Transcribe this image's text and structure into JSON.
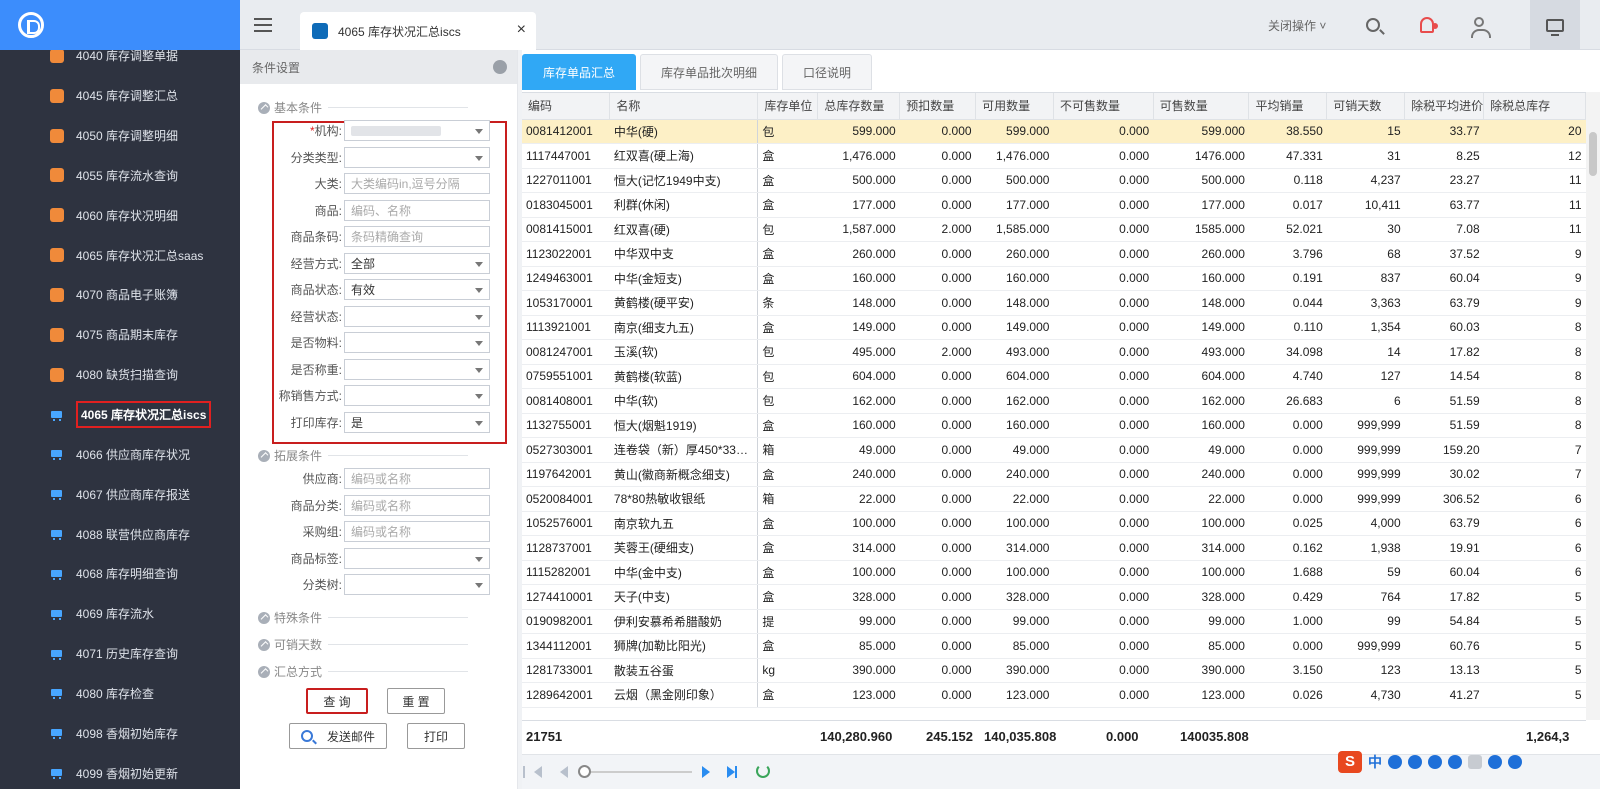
{
  "sidebar": {
    "items": [
      {
        "label": "4040 库存调整单据",
        "icon": "or"
      },
      {
        "label": "4045 库存调整汇总",
        "icon": "or"
      },
      {
        "label": "4050 库存调整明细",
        "icon": "or"
      },
      {
        "label": "4055 库存流水查询",
        "icon": "or"
      },
      {
        "label": "4060 库存状况明细",
        "icon": "or"
      },
      {
        "label": "4065 库存状况汇总saas",
        "icon": "or"
      },
      {
        "label": "4070 商品电子账簿",
        "icon": "or"
      },
      {
        "label": "4075 商品期末库存",
        "icon": "or"
      },
      {
        "label": "4080 缺货扫描查询",
        "icon": "or"
      },
      {
        "label": "4065 库存状况汇总iscs",
        "icon": "cart",
        "selected": true
      },
      {
        "label": "4066 供应商库存状况",
        "icon": "cart"
      },
      {
        "label": "4067 供应商库存报送",
        "icon": "cart"
      },
      {
        "label": "4088 联营供应商库存",
        "icon": "cart"
      },
      {
        "label": "4068 库存明细查询",
        "icon": "cart"
      },
      {
        "label": "4069 库存流水",
        "icon": "cart"
      },
      {
        "label": "4071 历史库存查询",
        "icon": "cart"
      },
      {
        "label": "4080 库存检查",
        "icon": "cart"
      },
      {
        "label": "4098 香烟初始库存",
        "icon": "cart"
      },
      {
        "label": "4099 香烟初始更新",
        "icon": "cart"
      }
    ]
  },
  "topbar": {
    "tab_title": "4065 库存状况汇总iscs",
    "close_tab": "×",
    "close_ops": "关闭操作 ˅"
  },
  "panel": {
    "title": "条件设置",
    "sections": {
      "basic": "基本条件",
      "extend": "拓展条件",
      "special": "特殊条件",
      "days": "可销天数",
      "summary": "汇总方式"
    },
    "basic_fields": [
      {
        "label": "机构:",
        "required": "*",
        "value": "",
        "select": true,
        "blurred": true
      },
      {
        "label": "分类类型:",
        "value": "",
        "select": true
      },
      {
        "label": "大类:",
        "value": "大类编码in,逗号分隔",
        "placeholder": true
      },
      {
        "label": "商品:",
        "value": "编码、名称",
        "placeholder": true
      },
      {
        "label": "商品条码:",
        "value": "条码精确查询",
        "placeholder": true
      },
      {
        "label": "经营方式:",
        "value": "全部",
        "select": true
      },
      {
        "label": "商品状态:",
        "value": "有效",
        "select": true
      },
      {
        "label": "经营状态:",
        "value": "",
        "select": true
      },
      {
        "label": "是否物料:",
        "value": "",
        "select": true
      },
      {
        "label": "是否称重:",
        "value": "",
        "select": true
      },
      {
        "label": "称销售方式:",
        "value": "",
        "select": true
      },
      {
        "label": "打印库存:",
        "value": "是",
        "select": true
      }
    ],
    "extend_fields": [
      {
        "label": "供应商:",
        "value": "编码或名称",
        "placeholder": true
      },
      {
        "label": "商品分类:",
        "value": "编码或名称",
        "placeholder": true
      },
      {
        "label": "采购组:",
        "value": "编码或名称",
        "placeholder": true
      },
      {
        "label": "商品标签:",
        "value": "",
        "select": true
      },
      {
        "label": "分类树:",
        "value": "",
        "select": true
      }
    ],
    "buttons": {
      "query": "查 询",
      "reset": "重 置",
      "send": "发送邮件",
      "print": "打印"
    }
  },
  "main": {
    "tabs": [
      "库存单品汇总",
      "库存单品批次明细",
      "口径说明"
    ],
    "columns": [
      "编码",
      "名称",
      "库存单位",
      "总库存数量",
      "预扣数量",
      "可用数量",
      "不可售数量",
      "可售数量",
      "平均销量",
      "可销天数",
      "除税平均进价",
      "除税总库存"
    ],
    "rows": [
      [
        "0081412001",
        "中华(硬)",
        "包",
        "599.000",
        "0.000",
        "599.000",
        "0.000",
        "599.000",
        "38.550",
        "15",
        "33.77",
        "20"
      ],
      [
        "1117447001",
        "红双喜(硬上海)",
        "盒",
        "1,476.000",
        "0.000",
        "1,476.000",
        "0.000",
        "1476.000",
        "47.331",
        "31",
        "8.25",
        "12"
      ],
      [
        "1227011001",
        "恒大(记忆1949中支)",
        "盒",
        "500.000",
        "0.000",
        "500.000",
        "0.000",
        "500.000",
        "0.118",
        "4,237",
        "23.27",
        "11"
      ],
      [
        "0183045001",
        "利群(休闲)",
        "盒",
        "177.000",
        "0.000",
        "177.000",
        "0.000",
        "177.000",
        "0.017",
        "10,411",
        "63.77",
        "11"
      ],
      [
        "0081415001",
        "红双喜(硬)",
        "包",
        "1,587.000",
        "2.000",
        "1,585.000",
        "0.000",
        "1585.000",
        "52.021",
        "30",
        "7.08",
        "11"
      ],
      [
        "1123022001",
        "中华双中支",
        "盒",
        "260.000",
        "0.000",
        "260.000",
        "0.000",
        "260.000",
        "3.796",
        "68",
        "37.52",
        "9"
      ],
      [
        "1249463001",
        "中华(金短支)",
        "盒",
        "160.000",
        "0.000",
        "160.000",
        "0.000",
        "160.000",
        "0.191",
        "837",
        "60.04",
        "9"
      ],
      [
        "1053170001",
        "黄鹤楼(硬平安)",
        "条",
        "148.000",
        "0.000",
        "148.000",
        "0.000",
        "148.000",
        "0.044",
        "3,363",
        "63.79",
        "9"
      ],
      [
        "1113921001",
        "南京(细支九五)",
        "盒",
        "149.000",
        "0.000",
        "149.000",
        "0.000",
        "149.000",
        "0.110",
        "1,354",
        "60.03",
        "8"
      ],
      [
        "0081247001",
        "玉溪(软)",
        "包",
        "495.000",
        "2.000",
        "493.000",
        "0.000",
        "493.000",
        "34.098",
        "14",
        "17.82",
        "8"
      ],
      [
        "0759551001",
        "黄鹤楼(软蓝)",
        "包",
        "604.000",
        "0.000",
        "604.000",
        "0.000",
        "604.000",
        "4.740",
        "127",
        "14.54",
        "8"
      ],
      [
        "0081408001",
        "中华(软)",
        "包",
        "162.000",
        "0.000",
        "162.000",
        "0.000",
        "162.000",
        "26.683",
        "6",
        "51.59",
        "8"
      ],
      [
        "1132755001",
        "恒大(烟魁1919)",
        "盒",
        "160.000",
        "0.000",
        "160.000",
        "0.000",
        "160.000",
        "0.000",
        "999,999",
        "51.59",
        "8"
      ],
      [
        "0527303001",
        "连卷袋（新）厚450*33…",
        "箱",
        "49.000",
        "0.000",
        "49.000",
        "0.000",
        "49.000",
        "0.000",
        "999,999",
        "159.20",
        "7"
      ],
      [
        "1197642001",
        "黄山(徽商新概念细支)",
        "盒",
        "240.000",
        "0.000",
        "240.000",
        "0.000",
        "240.000",
        "0.000",
        "999,999",
        "30.02",
        "7"
      ],
      [
        "0520084001",
        "78*80热敏收银纸",
        "箱",
        "22.000",
        "0.000",
        "22.000",
        "0.000",
        "22.000",
        "0.000",
        "999,999",
        "306.52",
        "6"
      ],
      [
        "1052576001",
        "南京软九五",
        "盒",
        "100.000",
        "0.000",
        "100.000",
        "0.000",
        "100.000",
        "0.025",
        "4,000",
        "63.79",
        "6"
      ],
      [
        "1128737001",
        "芙蓉王(硬细支)",
        "盒",
        "314.000",
        "0.000",
        "314.000",
        "0.000",
        "314.000",
        "0.162",
        "1,938",
        "19.91",
        "6"
      ],
      [
        "1115282001",
        "中华(金中支)",
        "盒",
        "100.000",
        "0.000",
        "100.000",
        "0.000",
        "100.000",
        "1.688",
        "59",
        "60.04",
        "6"
      ],
      [
        "1274410001",
        "天子(中支)",
        "盒",
        "328.000",
        "0.000",
        "328.000",
        "0.000",
        "328.000",
        "0.429",
        "764",
        "17.82",
        "5"
      ],
      [
        "0190982001",
        "伊利安慕希希腊酸奶",
        "提",
        "99.000",
        "0.000",
        "99.000",
        "0.000",
        "99.000",
        "1.000",
        "99",
        "54.84",
        "5"
      ],
      [
        "1344112001",
        "狮牌(加勒比阳光)",
        "盒",
        "85.000",
        "0.000",
        "85.000",
        "0.000",
        "85.000",
        "0.000",
        "999,999",
        "60.76",
        "5"
      ],
      [
        "1281733001",
        "散装五谷蛋",
        "kg",
        "390.000",
        "0.000",
        "390.000",
        "0.000",
        "390.000",
        "3.150",
        "123",
        "13.13",
        "5"
      ],
      [
        "1289642001",
        "云烟（黑金刚印象）",
        "盒",
        "123.000",
        "0.000",
        "123.000",
        "0.000",
        "123.000",
        "0.026",
        "4,730",
        "41.27",
        "5"
      ]
    ],
    "totals": {
      "count": "21751",
      "total_qty": "140,280.960",
      "withheld": "245.152",
      "available": "140,035.808",
      "unsellable": "0.000",
      "sellable": "140035.808",
      "tax_total": "1,264,3"
    }
  },
  "ime": {
    "logo": "S",
    "lang": "中"
  }
}
